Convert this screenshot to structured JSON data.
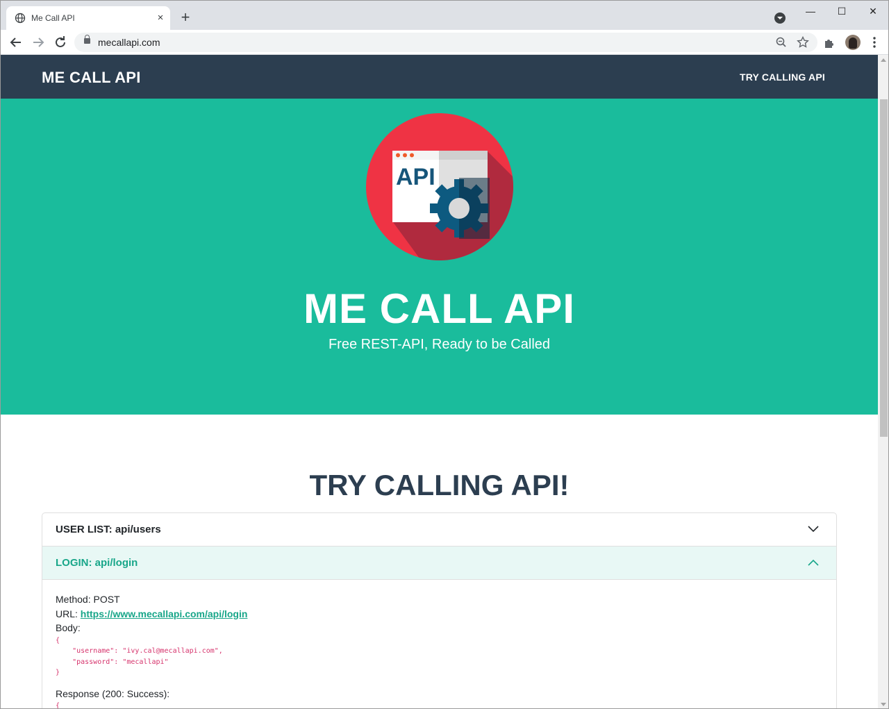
{
  "browser": {
    "tab_title": "Me Call API",
    "tab_close": "×",
    "new_tab": "+",
    "url": "mecallapi.com",
    "window_controls": {
      "minimize": "—",
      "maximize": "☐",
      "close": "✕"
    },
    "icons": [
      "globe-icon",
      "back-arrow-icon",
      "forward-arrow-icon",
      "reload-icon",
      "lock-icon",
      "zoom-icon",
      "star-icon",
      "extensions-icon",
      "profile-avatar",
      "menu-icon"
    ]
  },
  "site": {
    "brand": "ME CALL API",
    "nav_link": "TRY CALLING API"
  },
  "hero": {
    "logo_text": "API",
    "title": "ME CALL API",
    "subtitle": "Free REST-API, Ready to be Called"
  },
  "section": {
    "title": "TRY CALLING API!"
  },
  "accordion": {
    "items": [
      {
        "label": "USER LIST: api/users",
        "expanded": false
      },
      {
        "label": "LOGIN: api/login",
        "expanded": true
      }
    ],
    "login": {
      "method_label": "Method:",
      "method": "POST",
      "url_label": "URL:",
      "url": "https://www.mecallapi.com/api/login",
      "body_label": "Body:",
      "body_code": "{\n    \"username\": \"ivy.cal@mecallapi.com\",\n    \"password\": \"mecallapi\"\n}",
      "response_label": "Response (200: Success):",
      "response_code": "{"
    }
  },
  "colors": {
    "navbar": "#2c3e50",
    "hero": "#1abc9c",
    "accent_text": "#18a689",
    "code": "#d6336c"
  }
}
